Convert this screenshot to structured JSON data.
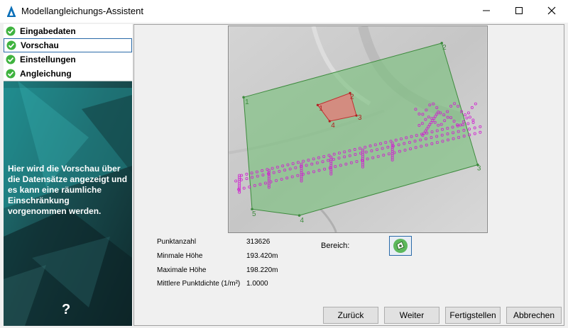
{
  "window": {
    "title": "Modellangleichungs-Assistent"
  },
  "steps": [
    {
      "label": "Eingabedaten"
    },
    {
      "label": "Vorschau"
    },
    {
      "label": "Einstellungen"
    },
    {
      "label": "Angleichung"
    }
  ],
  "sidebar": {
    "description": "Hier wird die Vorschau über die Datensätze angezeigt und es kann eine räumliche Einschränkung vorgenommen werden.",
    "help": "?"
  },
  "preview": {
    "outer_labels": [
      "1",
      "2",
      "3",
      "4",
      "5"
    ],
    "inner_labels": [
      "1",
      "2",
      "3",
      "4"
    ],
    "outer_fill": "#78c07a",
    "inner_fill": "#e77a78",
    "points_color": "#d020d0"
  },
  "stats": [
    {
      "label": "Punktanzahl",
      "value": "313626"
    },
    {
      "label": "Minmale Höhe",
      "value": "193.420m"
    },
    {
      "label": "Maximale Höhe",
      "value": "198.220m"
    },
    {
      "label": "Mittlere Punktdichte (1/m²)",
      "value": "1.0000"
    }
  ],
  "bereich": {
    "label": "Bereich:"
  },
  "buttons": {
    "back": "Zurück",
    "next": "Weiter",
    "finish": "Fertigstellen",
    "cancel": "Abbrechen"
  }
}
